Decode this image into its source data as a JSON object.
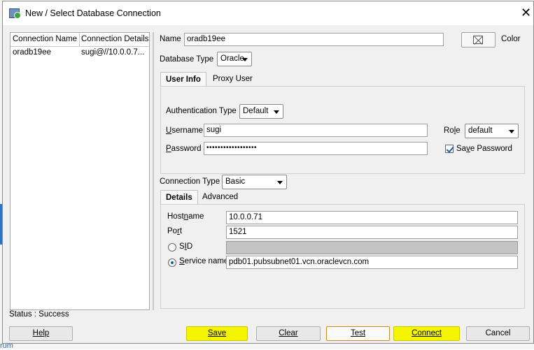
{
  "window": {
    "title": "New / Select Database Connection"
  },
  "connections": {
    "headers": [
      "Connection Name",
      "Connection Details"
    ],
    "rows": [
      {
        "name": "oradb19ee",
        "details": "sugi@//10.0.0.7..."
      }
    ]
  },
  "form": {
    "name_label": "Name",
    "name_value": "oradb19ee",
    "color_label": "Color",
    "db_type_label": "Database Type",
    "db_type_value": "Oracle",
    "tabs": [
      {
        "label": "User Info",
        "active": true
      },
      {
        "label": "Proxy User",
        "active": false
      }
    ],
    "auth_type_label": "Authentication Type",
    "auth_type_value": "Default",
    "username_label": "Username",
    "username_value": "sugi",
    "role_label": "Role",
    "role_value": "default",
    "password_label": "Password",
    "password_value": "••••••••••••••••••",
    "save_password_label": "Save Password",
    "save_password_checked": true,
    "conn_type_label": "Connection Type",
    "conn_type_value": "Basic",
    "conn_tabs": [
      {
        "label": "Details",
        "active": true
      },
      {
        "label": "Advanced",
        "active": false
      }
    ],
    "hostname_label": "Hostname",
    "hostname_value": "10.0.0.71",
    "port_label": "Port",
    "port_value": "1521",
    "sid_label": "SID",
    "sid_value": "",
    "service_label": "Service name",
    "service_value": "pdb01.pubsubnet01.vcn.oraclevcn.com",
    "selected_radio": "service"
  },
  "status": {
    "text": "Status : Success"
  },
  "buttons": {
    "help": "Help",
    "save": "Save",
    "clear": "Clear",
    "test": "Test",
    "connect": "Connect",
    "cancel": "Cancel"
  },
  "colors": {
    "highlight": "#f5f500",
    "dialog_bg": "#f0f0f0",
    "radio_accent": "#1b5fa8"
  },
  "background_fragment": {
    "text": "rum"
  }
}
